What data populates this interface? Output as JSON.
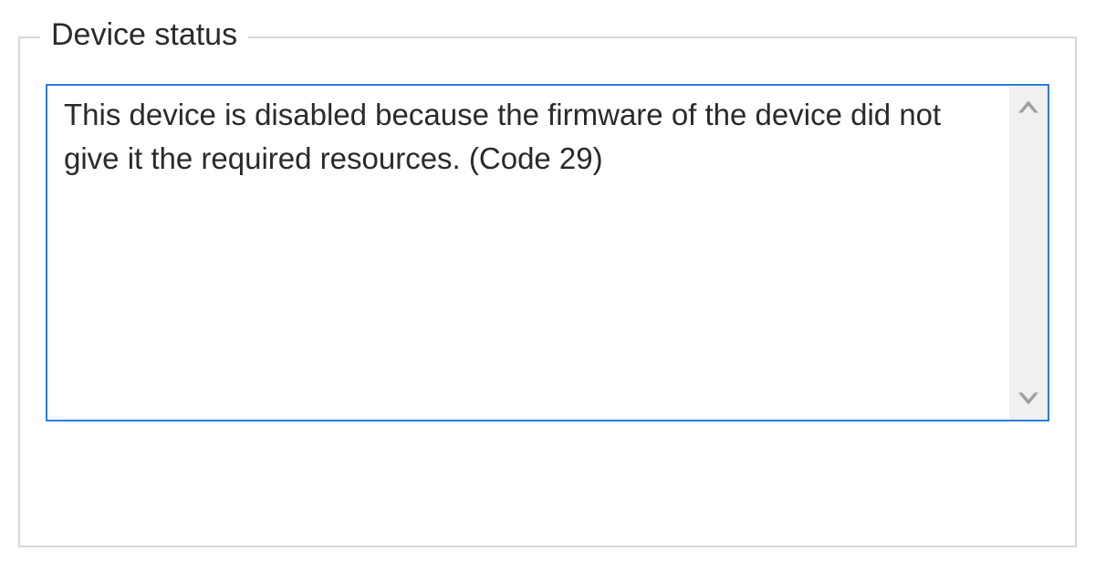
{
  "group": {
    "title": "Device status"
  },
  "status": {
    "message": "This device is disabled because the firmware of the device did not give it the required resources. (Code 29)"
  }
}
